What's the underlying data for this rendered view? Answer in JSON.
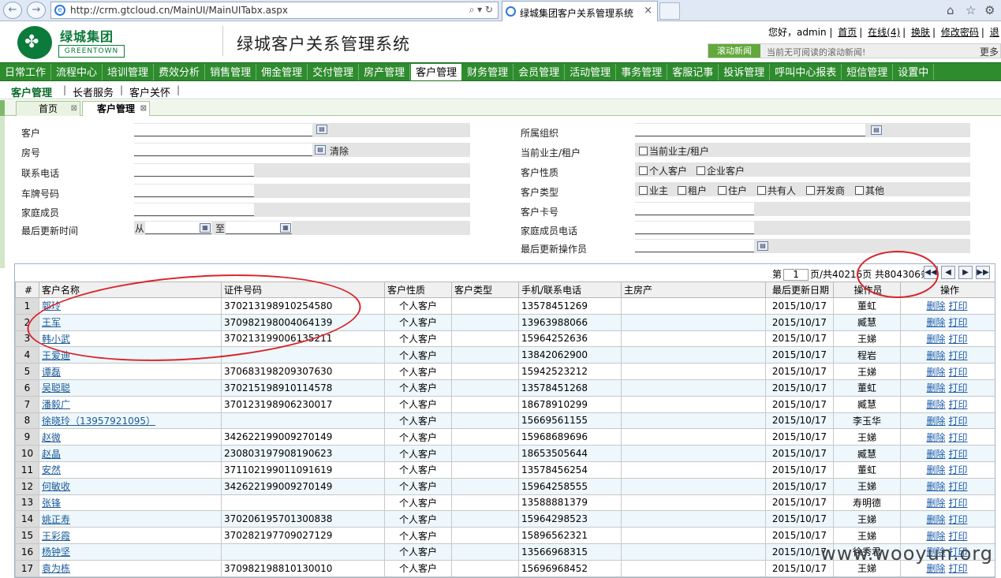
{
  "browser": {
    "url": "http://crm.gtcloud.cn/MainUI/MainUITabx.aspx",
    "tab_title": "绿城集团客户关系管理系统",
    "addr_tools": "⌕ ▾ ↻"
  },
  "header": {
    "logo_cn": "绿城集团",
    "logo_en": "GREENTOWN",
    "system_title": "绿城客户关系管理系统",
    "greeting": "您好，admin",
    "links": [
      "首页",
      "在线(4)",
      "换肤",
      "修改密码",
      "退"
    ],
    "news_label": "滚动新闻",
    "news_text": "当前无可阅读的滚动新闻!",
    "news_more": "更多"
  },
  "main_menu": [
    "日常工作",
    "流程中心",
    "培训管理",
    "费效分析",
    "销售管理",
    "佣金管理",
    "交付管理",
    "房产管理",
    "客户管理",
    "财务管理",
    "会员管理",
    "活动管理",
    "事务管理",
    "客服记事",
    "投诉管理",
    "呼叫中心报表",
    "短信管理",
    "设置中"
  ],
  "main_menu_active": "客户管理",
  "sub_menu": [
    "客户管理",
    "长者服务",
    "客户关怀"
  ],
  "page_tabs": [
    "首页",
    "客户管理"
  ],
  "form": {
    "left_labels": [
      "客户",
      "房号",
      "联系电话",
      "车牌号码",
      "家庭成员",
      "最后更新时间"
    ],
    "clear_label": "清除",
    "date_from": "从",
    "date_to": "至",
    "right_labels": [
      "所属组织",
      "当前业主/租户",
      "客户性质",
      "客户类型",
      "客户卡号",
      "家庭成员电话",
      "最后更新操作员"
    ],
    "current_owner_option": "当前业主/租户",
    "nature_options": [
      "个人客户",
      "企业客户"
    ],
    "type_options": [
      "业主",
      "租户",
      "住户",
      "共有人",
      "开发商",
      "其他"
    ]
  },
  "pager": {
    "prefix": "第",
    "page": "1",
    "suffix": "页/共40216页 共804306条"
  },
  "grid": {
    "headers": [
      "#",
      "客户名称",
      "证件号码",
      "客户性质",
      "客户类型",
      "手机/联系电话",
      "主房产",
      "最后更新日期",
      "操作员",
      "操作"
    ],
    "action_delete": "删除",
    "action_print": "打印",
    "rows": [
      {
        "n": "1",
        "name": "郭玲",
        "id": "370213198910254580",
        "nature": "个人客户",
        "type": "",
        "phone": "13578451269",
        "house": "",
        "date": "2015/10/17",
        "op": "董虹"
      },
      {
        "n": "2",
        "name": "王军",
        "id": "370982198004064139",
        "nature": "个人客户",
        "type": "",
        "phone": "13963988066",
        "house": "",
        "date": "2015/10/17",
        "op": "臧慧"
      },
      {
        "n": "3",
        "name": "韩小武",
        "id": "370213199006135211",
        "nature": "个人客户",
        "type": "",
        "phone": "15964252636",
        "house": "",
        "date": "2015/10/17",
        "op": "王娣"
      },
      {
        "n": "4",
        "name": "王爱迪",
        "id": "",
        "nature": "个人客户",
        "type": "",
        "phone": "13842062900",
        "house": "",
        "date": "2015/10/17",
        "op": "程岩"
      },
      {
        "n": "5",
        "name": "谭磊",
        "id": "370683198209307630",
        "nature": "个人客户",
        "type": "",
        "phone": "15942523212",
        "house": "",
        "date": "2015/10/17",
        "op": "王娣"
      },
      {
        "n": "6",
        "name": "吴聪聪",
        "id": "370215198910114578",
        "nature": "个人客户",
        "type": "",
        "phone": "13578451268",
        "house": "",
        "date": "2015/10/17",
        "op": "董虹"
      },
      {
        "n": "7",
        "name": "潘毅广",
        "id": "370123198906230017",
        "nature": "个人客户",
        "type": "",
        "phone": "18678910299",
        "house": "",
        "date": "2015/10/17",
        "op": "臧慧"
      },
      {
        "n": "8",
        "name": "徐晓玲（13957921095）",
        "id": "",
        "nature": "个人客户",
        "type": "",
        "phone": "15669561155",
        "house": "",
        "date": "2015/10/17",
        "op": "李玉华"
      },
      {
        "n": "9",
        "name": "赵微",
        "id": "342622199009270149",
        "nature": "个人客户",
        "type": "",
        "phone": "15968689696",
        "house": "",
        "date": "2015/10/17",
        "op": "王娣"
      },
      {
        "n": "10",
        "name": "赵晶",
        "id": "230803197908190623",
        "nature": "个人客户",
        "type": "",
        "phone": "18653505644",
        "house": "",
        "date": "2015/10/17",
        "op": "臧慧"
      },
      {
        "n": "11",
        "name": "安然",
        "id": "371102199011091619",
        "nature": "个人客户",
        "type": "",
        "phone": "13578456254",
        "house": "",
        "date": "2015/10/17",
        "op": "董虹"
      },
      {
        "n": "12",
        "name": "何敏收",
        "id": "342622199009270149",
        "nature": "个人客户",
        "type": "",
        "phone": "15964258555",
        "house": "",
        "date": "2015/10/17",
        "op": "王娣"
      },
      {
        "n": "13",
        "name": "张锋",
        "id": "",
        "nature": "个人客户",
        "type": "",
        "phone": "13588881379",
        "house": "",
        "date": "2015/10/17",
        "op": "寿明德"
      },
      {
        "n": "14",
        "name": "姚正寿",
        "id": "370206195701300838",
        "nature": "个人客户",
        "type": "",
        "phone": "15964298523",
        "house": "",
        "date": "2015/10/17",
        "op": "王娣"
      },
      {
        "n": "15",
        "name": "王彩霞",
        "id": "370282197709027129",
        "nature": "个人客户",
        "type": "",
        "phone": "15896562321",
        "house": "",
        "date": "2015/10/17",
        "op": "王娣"
      },
      {
        "n": "16",
        "name": "杨钟坚",
        "id": "",
        "nature": "个人客户",
        "type": "",
        "phone": "13566968315",
        "house": "",
        "date": "2015/10/17",
        "op": "徐秀君"
      },
      {
        "n": "17",
        "name": "袁为栋",
        "id": "370982198810130010",
        "nature": "个人客户",
        "type": "",
        "phone": "15696968452",
        "house": "",
        "date": "2015/10/17",
        "op": "王娣"
      }
    ]
  },
  "watermark": "www.wooyun.org",
  "colors": {
    "menu_green": "#2e8b2e",
    "brand_green": "#0b7a3a",
    "annotation_red": "#d9232a",
    "link_blue": "#1a5a9a"
  }
}
